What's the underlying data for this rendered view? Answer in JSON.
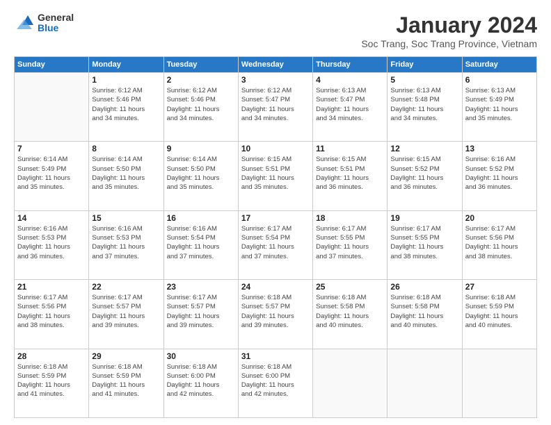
{
  "logo": {
    "general": "General",
    "blue": "Blue"
  },
  "header": {
    "title": "January 2024",
    "subtitle": "Soc Trang, Soc Trang Province, Vietnam"
  },
  "days_of_week": [
    "Sunday",
    "Monday",
    "Tuesday",
    "Wednesday",
    "Thursday",
    "Friday",
    "Saturday"
  ],
  "weeks": [
    [
      {
        "num": "",
        "info": ""
      },
      {
        "num": "1",
        "info": "Sunrise: 6:12 AM\nSunset: 5:46 PM\nDaylight: 11 hours\nand 34 minutes."
      },
      {
        "num": "2",
        "info": "Sunrise: 6:12 AM\nSunset: 5:46 PM\nDaylight: 11 hours\nand 34 minutes."
      },
      {
        "num": "3",
        "info": "Sunrise: 6:12 AM\nSunset: 5:47 PM\nDaylight: 11 hours\nand 34 minutes."
      },
      {
        "num": "4",
        "info": "Sunrise: 6:13 AM\nSunset: 5:47 PM\nDaylight: 11 hours\nand 34 minutes."
      },
      {
        "num": "5",
        "info": "Sunrise: 6:13 AM\nSunset: 5:48 PM\nDaylight: 11 hours\nand 34 minutes."
      },
      {
        "num": "6",
        "info": "Sunrise: 6:13 AM\nSunset: 5:49 PM\nDaylight: 11 hours\nand 35 minutes."
      }
    ],
    [
      {
        "num": "7",
        "info": "Sunrise: 6:14 AM\nSunset: 5:49 PM\nDaylight: 11 hours\nand 35 minutes."
      },
      {
        "num": "8",
        "info": "Sunrise: 6:14 AM\nSunset: 5:50 PM\nDaylight: 11 hours\nand 35 minutes."
      },
      {
        "num": "9",
        "info": "Sunrise: 6:14 AM\nSunset: 5:50 PM\nDaylight: 11 hours\nand 35 minutes."
      },
      {
        "num": "10",
        "info": "Sunrise: 6:15 AM\nSunset: 5:51 PM\nDaylight: 11 hours\nand 35 minutes."
      },
      {
        "num": "11",
        "info": "Sunrise: 6:15 AM\nSunset: 5:51 PM\nDaylight: 11 hours\nand 36 minutes."
      },
      {
        "num": "12",
        "info": "Sunrise: 6:15 AM\nSunset: 5:52 PM\nDaylight: 11 hours\nand 36 minutes."
      },
      {
        "num": "13",
        "info": "Sunrise: 6:16 AM\nSunset: 5:52 PM\nDaylight: 11 hours\nand 36 minutes."
      }
    ],
    [
      {
        "num": "14",
        "info": "Sunrise: 6:16 AM\nSunset: 5:53 PM\nDaylight: 11 hours\nand 36 minutes."
      },
      {
        "num": "15",
        "info": "Sunrise: 6:16 AM\nSunset: 5:53 PM\nDaylight: 11 hours\nand 37 minutes."
      },
      {
        "num": "16",
        "info": "Sunrise: 6:16 AM\nSunset: 5:54 PM\nDaylight: 11 hours\nand 37 minutes."
      },
      {
        "num": "17",
        "info": "Sunrise: 6:17 AM\nSunset: 5:54 PM\nDaylight: 11 hours\nand 37 minutes."
      },
      {
        "num": "18",
        "info": "Sunrise: 6:17 AM\nSunset: 5:55 PM\nDaylight: 11 hours\nand 37 minutes."
      },
      {
        "num": "19",
        "info": "Sunrise: 6:17 AM\nSunset: 5:55 PM\nDaylight: 11 hours\nand 38 minutes."
      },
      {
        "num": "20",
        "info": "Sunrise: 6:17 AM\nSunset: 5:56 PM\nDaylight: 11 hours\nand 38 minutes."
      }
    ],
    [
      {
        "num": "21",
        "info": "Sunrise: 6:17 AM\nSunset: 5:56 PM\nDaylight: 11 hours\nand 38 minutes."
      },
      {
        "num": "22",
        "info": "Sunrise: 6:17 AM\nSunset: 5:57 PM\nDaylight: 11 hours\nand 39 minutes."
      },
      {
        "num": "23",
        "info": "Sunrise: 6:17 AM\nSunset: 5:57 PM\nDaylight: 11 hours\nand 39 minutes."
      },
      {
        "num": "24",
        "info": "Sunrise: 6:18 AM\nSunset: 5:57 PM\nDaylight: 11 hours\nand 39 minutes."
      },
      {
        "num": "25",
        "info": "Sunrise: 6:18 AM\nSunset: 5:58 PM\nDaylight: 11 hours\nand 40 minutes."
      },
      {
        "num": "26",
        "info": "Sunrise: 6:18 AM\nSunset: 5:58 PM\nDaylight: 11 hours\nand 40 minutes."
      },
      {
        "num": "27",
        "info": "Sunrise: 6:18 AM\nSunset: 5:59 PM\nDaylight: 11 hours\nand 40 minutes."
      }
    ],
    [
      {
        "num": "28",
        "info": "Sunrise: 6:18 AM\nSunset: 5:59 PM\nDaylight: 11 hours\nand 41 minutes."
      },
      {
        "num": "29",
        "info": "Sunrise: 6:18 AM\nSunset: 5:59 PM\nDaylight: 11 hours\nand 41 minutes."
      },
      {
        "num": "30",
        "info": "Sunrise: 6:18 AM\nSunset: 6:00 PM\nDaylight: 11 hours\nand 42 minutes."
      },
      {
        "num": "31",
        "info": "Sunrise: 6:18 AM\nSunset: 6:00 PM\nDaylight: 11 hours\nand 42 minutes."
      },
      {
        "num": "",
        "info": ""
      },
      {
        "num": "",
        "info": ""
      },
      {
        "num": "",
        "info": ""
      }
    ]
  ]
}
